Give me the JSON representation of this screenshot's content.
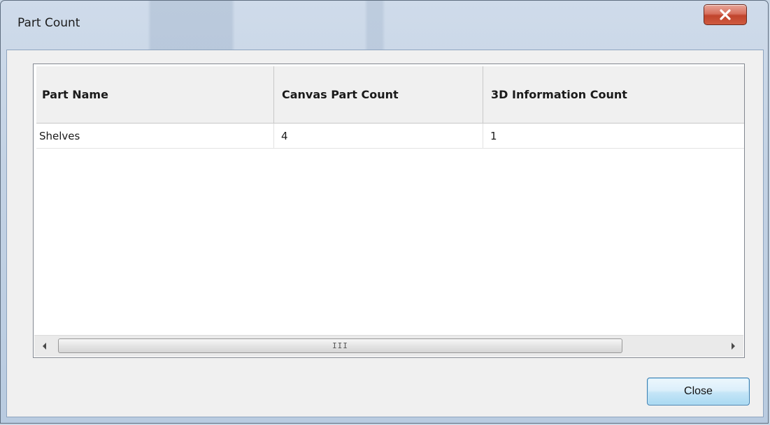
{
  "window": {
    "title": "Part Count",
    "close_icon": "close-x-icon"
  },
  "table": {
    "columns": [
      "Part Name",
      "Canvas Part Count",
      "3D Information Count"
    ],
    "rows": [
      [
        "Shelves",
        "4",
        "1"
      ]
    ]
  },
  "scrollbar": {
    "left_icon": "arrow-left-icon",
    "right_icon": "arrow-right-icon",
    "grip": "III"
  },
  "footer": {
    "close_label": "Close"
  },
  "colors": {
    "close_x_bg": "#c9472f",
    "button_border": "#3c7fb1",
    "client_bg": "#f0f0f0"
  }
}
